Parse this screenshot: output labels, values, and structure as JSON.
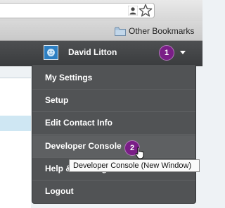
{
  "browser": {
    "bookmarks": {
      "other_bookmarks_label": "Other Bookmarks"
    },
    "icons": [
      "person-icon",
      "star-icon",
      "folder-icon"
    ]
  },
  "header": {
    "user_name": "David Litton",
    "step_1": "1"
  },
  "user_menu": {
    "items": [
      {
        "label": "My Settings"
      },
      {
        "label": "Setup"
      },
      {
        "label": "Edit Contact Info"
      },
      {
        "label": "Developer Console"
      },
      {
        "label": "Help & Training"
      },
      {
        "label": "Logout"
      }
    ],
    "step_2": "2",
    "tooltip": "Developer Console (New Window)"
  },
  "colors": {
    "header_bg": "#3f4143",
    "menu_bg": "#515355",
    "badge": "#7a1e87",
    "avatar": "#2d7fc2"
  }
}
